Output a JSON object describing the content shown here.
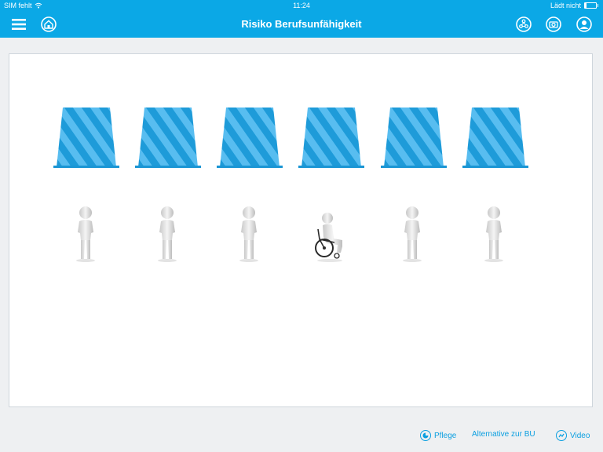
{
  "status_bar": {
    "carrier": "SIM fehlt",
    "time": "11:24",
    "battery_text": "Lädt nicht"
  },
  "header": {
    "title": "Risiko Berufsunfähigkeit",
    "menu_icon": "hamburger-menu-icon",
    "home_icon": "house-icon",
    "right_icons": [
      "network-icon",
      "camera-icon",
      "user-icon"
    ]
  },
  "scene": {
    "cup_count": 6,
    "people": [
      {
        "state": "standing"
      },
      {
        "state": "standing"
      },
      {
        "state": "standing"
      },
      {
        "state": "wheelchair"
      },
      {
        "state": "standing"
      },
      {
        "state": "standing"
      }
    ]
  },
  "footer": {
    "pflege_label": "Pflege",
    "alternative_label": "Alternative zur BU",
    "video_label": "Video"
  },
  "colors": {
    "accent": "#0ba8e6",
    "cup": "#2ea6e3",
    "link": "#0a9fe0"
  }
}
